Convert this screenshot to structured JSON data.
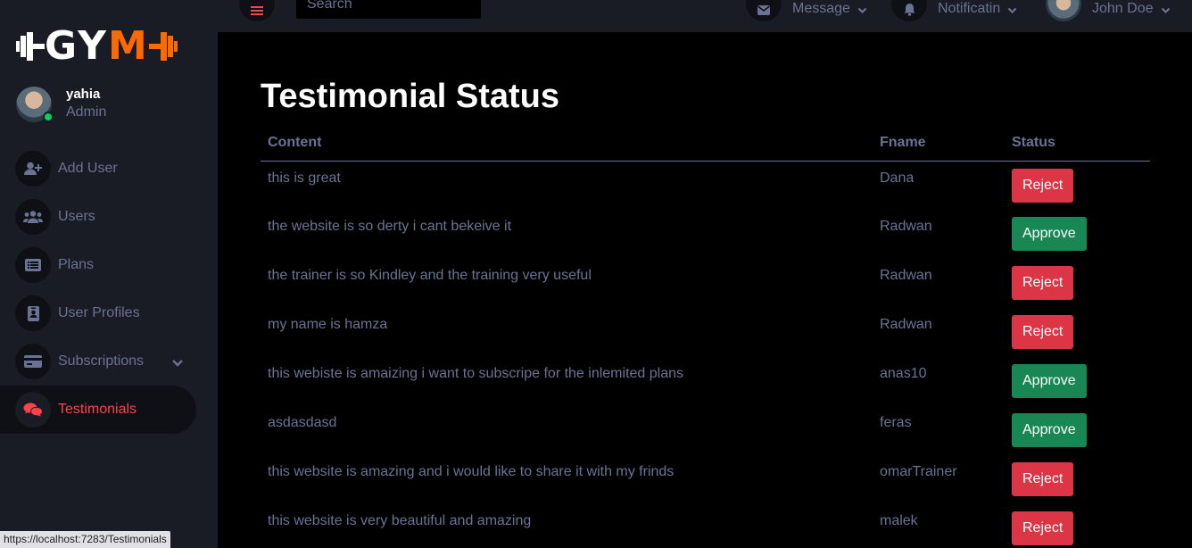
{
  "app": {
    "logo": {
      "left": "G",
      "mid": "Y",
      "right": "M"
    }
  },
  "sidebar": {
    "profile": {
      "name": "yahia",
      "role": "Admin"
    },
    "items": [
      {
        "label": "Add User",
        "icon": "add-user-icon"
      },
      {
        "label": "Users",
        "icon": "users-icon"
      },
      {
        "label": "Plans",
        "icon": "list-icon"
      },
      {
        "label": "User Profiles",
        "icon": "id-badge-icon"
      },
      {
        "label": "Subscriptions",
        "icon": "credit-card-icon"
      },
      {
        "label": "Testimonials",
        "icon": "comments-icon"
      }
    ],
    "active_color": "#fc424a"
  },
  "topbar": {
    "search_placeholder": "Search",
    "message_label": "Message",
    "notification_label": "Notificatin",
    "user_name": "John Doe"
  },
  "main": {
    "title": "Testimonial Status",
    "columns": [
      "Content",
      "Fname",
      "Status"
    ],
    "rows": [
      {
        "content": "this is great",
        "fname": "Dana",
        "status": "Reject"
      },
      {
        "content": "the website is so derty i cant bekeive it",
        "fname": "Radwan",
        "status": "Approve"
      },
      {
        "content": "the trainer is so Kindley and the training very useful",
        "fname": "Radwan",
        "status": "Reject"
      },
      {
        "content": "my name is hamza",
        "fname": "Radwan",
        "status": "Reject"
      },
      {
        "content": "this webiste is amaizing i want to subscripe for the inlemited plans",
        "fname": "anas10",
        "status": "Approve"
      },
      {
        "content": "asdasdasd",
        "fname": "feras",
        "status": "Approve"
      },
      {
        "content": "this website is amazing and i would like to share it with my frinds",
        "fname": "omarTrainer",
        "status": "Reject"
      },
      {
        "content": "this website is very beautiful and amazing",
        "fname": "malek",
        "status": "Reject"
      }
    ]
  },
  "status_bar": {
    "url": "https://localhost:7283/Testimonials"
  },
  "colors": {
    "sidebar_bg": "#191c24",
    "main_bg": "#000000",
    "muted_text": "#6c7293",
    "reject": "#dc3545",
    "approve": "#198754",
    "logo_accent": "#ff6a00"
  }
}
